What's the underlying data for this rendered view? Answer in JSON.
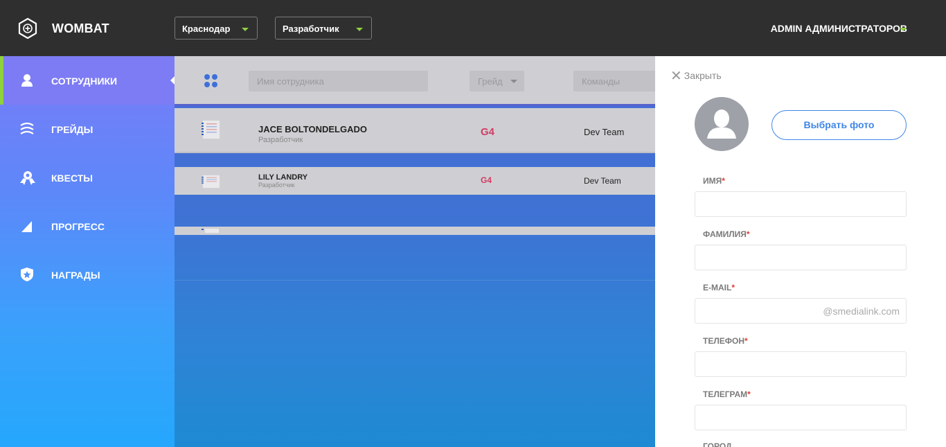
{
  "app": {
    "brand": "WOMBAT"
  },
  "header": {
    "city_select": "Краснодар",
    "role_select": "Разработчик",
    "user_name": "ADMIN АДМИНИСТРАТОРОВ"
  },
  "colors": {
    "accent_green": "#8fd13f",
    "primary_blue": "#3f86e6",
    "grade_red": "#d23b63",
    "sidebar_top": "#7a7bf6",
    "sidebar_bottom": "#25a7fd"
  },
  "sidebar": {
    "items": [
      {
        "label": "СОТРУДНИКИ",
        "icon": "person-icon",
        "active": true
      },
      {
        "label": "ГРЕЙДЫ",
        "icon": "layers-icon",
        "active": false
      },
      {
        "label": "КВЕСТЫ",
        "icon": "award-icon",
        "active": false
      },
      {
        "label": "ПРОГРЕСС",
        "icon": "chart-icon",
        "active": false
      },
      {
        "label": "НАГРАДЫ",
        "icon": "badge-icon",
        "active": false
      }
    ]
  },
  "filters": {
    "name_placeholder": "Имя сотрудника",
    "grade_placeholder": "Грейд",
    "team_placeholder": "Команды"
  },
  "employees": [
    {
      "name": "JACE BOLTONDELGADO",
      "role": "Разработчик",
      "grade": "G4",
      "team": "Dev Team"
    },
    {
      "name": "LILY LANDRY",
      "role": "Разработчик",
      "grade": "G4",
      "team": "Dev Team"
    }
  ],
  "panel": {
    "close_label": "Закрыть",
    "choose_photo": "Выбрать фото",
    "fields": [
      {
        "label": "ИМЯ",
        "required": "*",
        "value": ""
      },
      {
        "label": "ФАМИЛИЯ",
        "required": "*",
        "value": ""
      },
      {
        "label": "E-MAIL",
        "required": "*",
        "value": "@smedialink.com"
      },
      {
        "label": "ТЕЛЕФОН",
        "required": "*",
        "value": ""
      },
      {
        "label": "ТЕЛЕГРАМ",
        "required": "*",
        "value": ""
      },
      {
        "label": "ГОРОД",
        "required": "",
        "value": ""
      }
    ]
  }
}
